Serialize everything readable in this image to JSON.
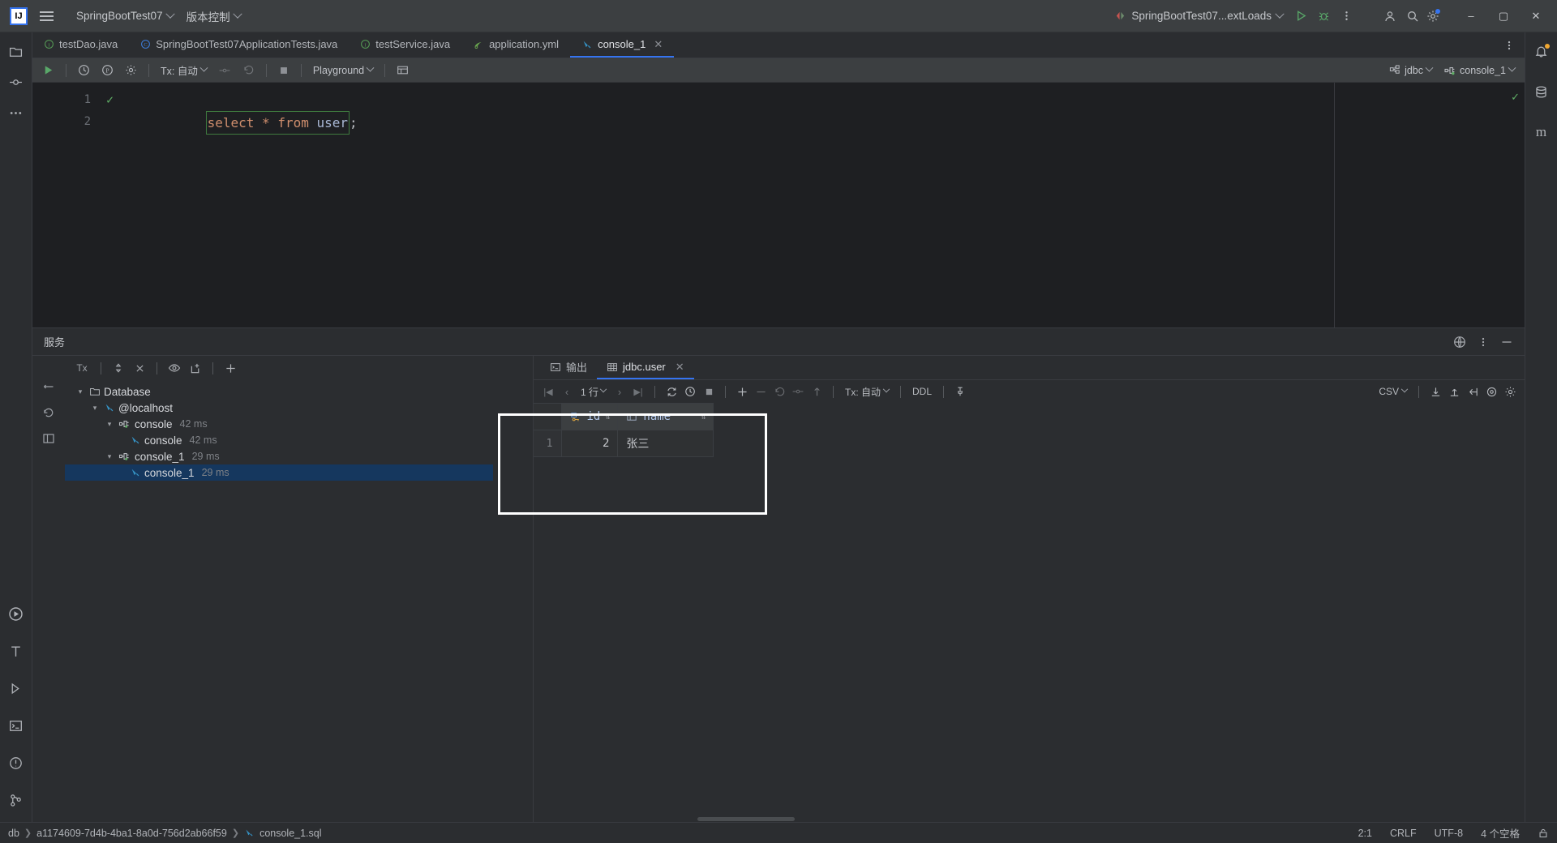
{
  "titlebar": {
    "logo": "IJ",
    "menu_icon": "hamburger-icon",
    "project_name": "SpringBootTest07",
    "vcs_label": "版本控制",
    "run_config": "SpringBootTest07...extLoads",
    "run_icon": "run-icon",
    "debug_icon": "debug-icon",
    "more_icon": "more-vertical-icon",
    "account_icon": "account-icon",
    "search_icon": "search-icon",
    "settings_icon": "settings-icon",
    "minimize": "–",
    "maximize": "▢",
    "close": "✕"
  },
  "editor_tabs": [
    {
      "label": "testDao.java",
      "icon": "interface-icon",
      "active": false
    },
    {
      "label": "SpringBootTest07ApplicationTests.java",
      "icon": "class-icon",
      "active": false
    },
    {
      "label": "testService.java",
      "icon": "interface-icon",
      "active": false
    },
    {
      "label": "application.yml",
      "icon": "yaml-icon",
      "active": false
    },
    {
      "label": "console_1",
      "icon": "sql-console-icon",
      "active": true,
      "closable": true
    }
  ],
  "sql_toolbar": {
    "execute": "execute-icon",
    "history": "history-icon",
    "parameters": "parameters-icon",
    "settings": "settings-icon",
    "tx_label": "Tx: 自动",
    "commit": "commit-icon",
    "rollback": "rollback-icon",
    "stop": "stop-icon",
    "schema": "Playground",
    "grid_icon": "table-icon",
    "datasource": "jdbc",
    "session": "console_1"
  },
  "editor": {
    "lines": [
      {
        "number": "1",
        "tokens": [
          {
            "text": "select",
            "type": "kw"
          },
          {
            "text": " ",
            "type": "punc"
          },
          {
            "text": "*",
            "type": "kw"
          },
          {
            "text": " ",
            "type": "punc"
          },
          {
            "text": "from",
            "type": "kw"
          },
          {
            "text": " ",
            "type": "punc"
          },
          {
            "text": "user",
            "type": "ident"
          }
        ],
        "trailing": ";",
        "has_check": true
      },
      {
        "number": "2",
        "tokens": [],
        "trailing": "",
        "has_check": false
      }
    ]
  },
  "services": {
    "title": "服务",
    "tree_toolbar": {
      "tx": "Tx",
      "expand": "expand-collapse-icon",
      "close": "close-icon",
      "eye": "eye-icon",
      "new_tab": "new-tab-icon",
      "plus": "plus-icon"
    },
    "tree": [
      {
        "depth": 0,
        "label": "Database",
        "icon": "folder-icon",
        "ms": "",
        "expanded": true,
        "selected": false
      },
      {
        "depth": 1,
        "label": "@localhost",
        "icon": "sql-console-icon",
        "ms": "",
        "expanded": true,
        "selected": false
      },
      {
        "depth": 2,
        "label": "console",
        "icon": "connection-icon",
        "ms": "42 ms",
        "expanded": true,
        "selected": false
      },
      {
        "depth": 3,
        "label": "console",
        "icon": "sql-console-icon",
        "ms": "42 ms",
        "expanded": false,
        "selected": false
      },
      {
        "depth": 2,
        "label": "console_1",
        "icon": "connection-icon",
        "ms": "29 ms",
        "expanded": true,
        "selected": false
      },
      {
        "depth": 3,
        "label": "console_1",
        "icon": "sql-console-icon",
        "ms": "29 ms",
        "expanded": false,
        "selected": true
      }
    ],
    "result_tabs": [
      {
        "label": "输出",
        "icon": "console-output-icon",
        "active": false,
        "closable": false
      },
      {
        "label": "jdbc.user",
        "icon": "table-icon",
        "active": true,
        "closable": true
      }
    ],
    "result_toolbar": {
      "first": "⏮",
      "prev": "‹",
      "rowcount": "1 行",
      "next": "›",
      "last": "⏭",
      "reload": "reload-icon",
      "page_time": "page-time-icon",
      "stop": "stop-icon",
      "add_row": "plus-icon",
      "delete_row": "minus-icon",
      "revert": "revert-icon",
      "commit": "commit-icon",
      "upload": "upload-icon",
      "tx_label": "Tx: 自动",
      "ddl": "DDL",
      "pin": "pin-icon",
      "format": "CSV",
      "download": "download-icon",
      "export": "export-icon",
      "open_in": "open-in-icon",
      "view": "view-icon",
      "gear": "settings-icon"
    },
    "grid": {
      "columns": [
        {
          "name": "id",
          "icon": "primary-key-icon"
        },
        {
          "name": "name",
          "icon": "column-icon"
        }
      ],
      "rows": [
        {
          "num": "1",
          "id": "2",
          "name": "张三"
        }
      ]
    }
  },
  "statusbar": {
    "breadcrumb": [
      {
        "label": "db",
        "icon": "database-icon"
      },
      {
        "label": "a1174609-7d4b-4ba1-8a0d-756d2ab66f59",
        "icon": "chevron-right-icon"
      },
      {
        "label": "console_1.sql",
        "icon": "sql-file-icon"
      }
    ],
    "caret": "2:1",
    "line_sep": "CRLF",
    "encoding": "UTF-8",
    "indent": "4 个空格",
    "lock_icon": "lock-icon"
  },
  "colors": {
    "accent": "#3574f0",
    "keyword": "#cf8e6d",
    "identifier": "#a8b7d4",
    "success": "#5fad65",
    "selection": "#15375e",
    "highlight_border": "#ffffff"
  }
}
